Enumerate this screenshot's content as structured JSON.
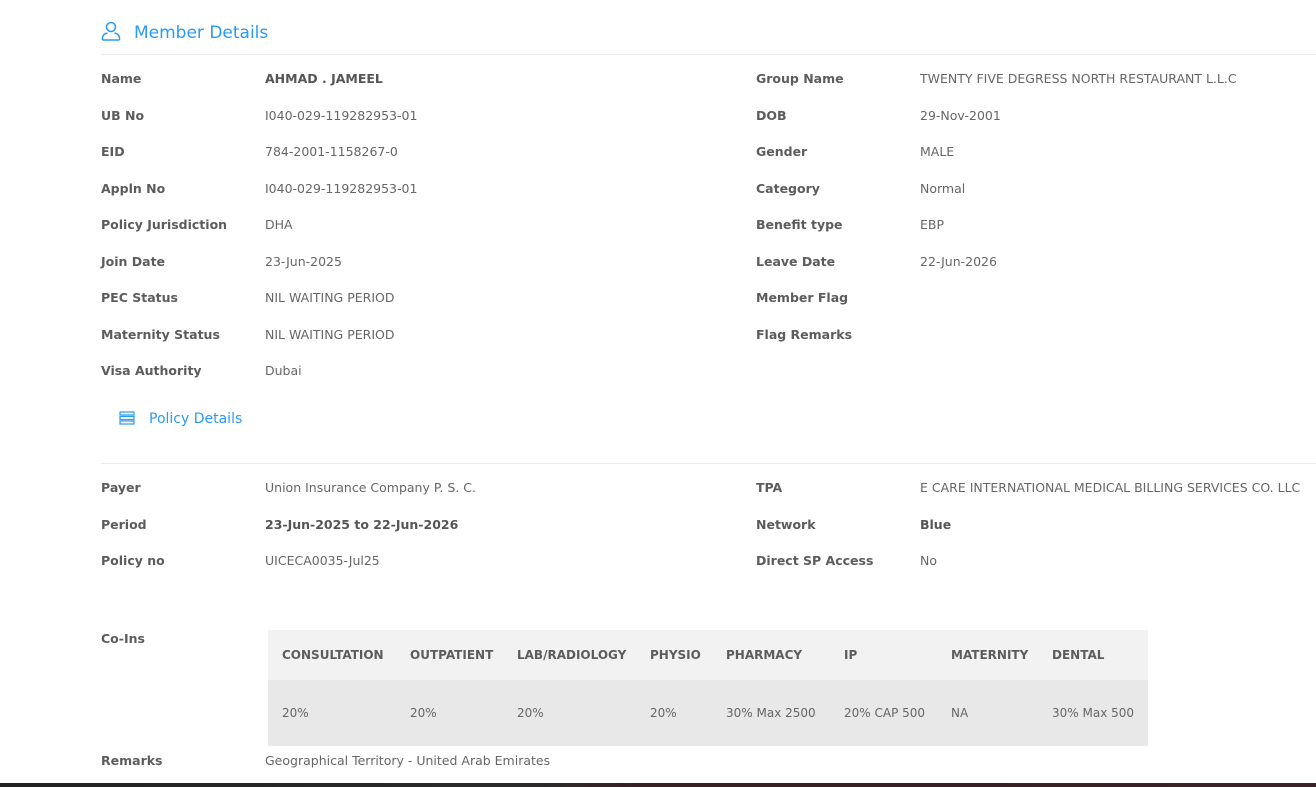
{
  "member": {
    "title": "Member Details",
    "icon": "user-icon",
    "left": [
      {
        "label": "Name",
        "value": "AHMAD . JAMEEL",
        "bold": true
      },
      {
        "label": "UB No",
        "value": "I040-029-119282953-01"
      },
      {
        "label": "EID",
        "value": "784-2001-1158267-0"
      },
      {
        "label": "Appln No",
        "value": "I040-029-119282953-01"
      },
      {
        "label": "Policy Jurisdiction",
        "value": "DHA"
      },
      {
        "label": "Join Date",
        "value": "23-Jun-2025"
      },
      {
        "label": "PEC Status",
        "value": "NIL WAITING PERIOD"
      },
      {
        "label": "Maternity Status",
        "value": "NIL WAITING PERIOD"
      },
      {
        "label": "Visa Authority",
        "value": "Dubai"
      }
    ],
    "right": [
      {
        "label": "Group Name",
        "value": "TWENTY FIVE DEGRESS NORTH RESTAURANT L.L.C"
      },
      {
        "label": "DOB",
        "value": "29-Nov-2001"
      },
      {
        "label": "Gender",
        "value": "MALE"
      },
      {
        "label": "Category",
        "value": "Normal"
      },
      {
        "label": "Benefit type",
        "value": "EBP"
      },
      {
        "label": "Leave Date",
        "value": "22-Jun-2026"
      },
      {
        "label": "Member Flag",
        "value": ""
      },
      {
        "label": "Flag Remarks",
        "value": ""
      }
    ]
  },
  "policy": {
    "title": "Policy Details",
    "icon": "list-icon",
    "left": [
      {
        "label": "Payer",
        "value": "Union Insurance Company P. S. C."
      },
      {
        "label": "Period",
        "value": "23-Jun-2025 to 22-Jun-2026",
        "bold": true
      },
      {
        "label": "Policy no",
        "value": "UICECA0035-Jul25"
      }
    ],
    "right": [
      {
        "label": "TPA",
        "value": "E CARE INTERNATIONAL MEDICAL BILLING SERVICES CO. LLC"
      },
      {
        "label": "Network",
        "value": "Blue",
        "bold": true
      },
      {
        "label": "Direct SP Access",
        "value": "No"
      }
    ]
  },
  "coins": {
    "label": "Co-Ins",
    "headers": [
      "CONSULTATION",
      "OUTPATIENT",
      "LAB/RADIOLOGY",
      "PHYSIO",
      "PHARMACY",
      "IP",
      "MATERNITY",
      "DENTAL"
    ],
    "values": [
      "20%",
      "20%",
      "20%",
      "20%",
      "30% Max 2500",
      "20% CAP 500",
      "NA",
      "30% Max 500"
    ]
  },
  "remarks": {
    "label": "Remarks",
    "value": "Geographical Territory - United Arab Emirates"
  }
}
